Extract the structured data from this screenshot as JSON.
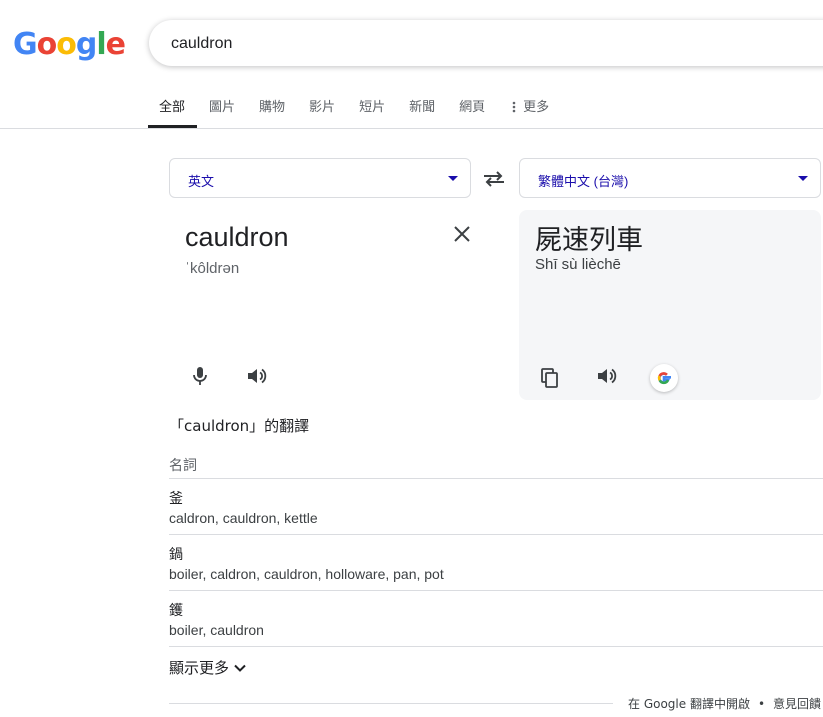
{
  "logo": {
    "letters": [
      "G",
      "o",
      "o",
      "g",
      "l",
      "e"
    ],
    "colors": [
      "#4285F4",
      "#EA4335",
      "#FBBC05",
      "#4285F4",
      "#34A853",
      "#EA4335"
    ]
  },
  "search": {
    "value": "cauldron"
  },
  "tabs": [
    {
      "label": "全部",
      "active": true
    },
    {
      "label": "圖片"
    },
    {
      "label": "購物"
    },
    {
      "label": "影片"
    },
    {
      "label": "短片"
    },
    {
      "label": "新聞"
    },
    {
      "label": "網頁"
    },
    {
      "label": "更多"
    }
  ],
  "translator": {
    "source_lang": "英文",
    "target_lang": "繁體中文 (台灣)",
    "source_word": "cauldron",
    "source_phonetic": "ˈkôldrən",
    "target_word": "屍速列車",
    "target_romanization": "Shī sù lièchē",
    "accent_color": "#1a0dab"
  },
  "translations": {
    "title": "「cauldron」的翻譯",
    "part_of_speech": "名詞",
    "rows": [
      {
        "word": "釜",
        "synonyms": "caldron, cauldron, kettle"
      },
      {
        "word": "鍋",
        "synonyms": "boiler, caldron, cauldron, holloware, pan, pot"
      },
      {
        "word": "鑊",
        "synonyms": "boiler, cauldron"
      }
    ],
    "show_more": "顯示更多"
  },
  "footer": {
    "open_in": "在 Google 翻譯中開啟",
    "feedback": "意見回饋"
  }
}
